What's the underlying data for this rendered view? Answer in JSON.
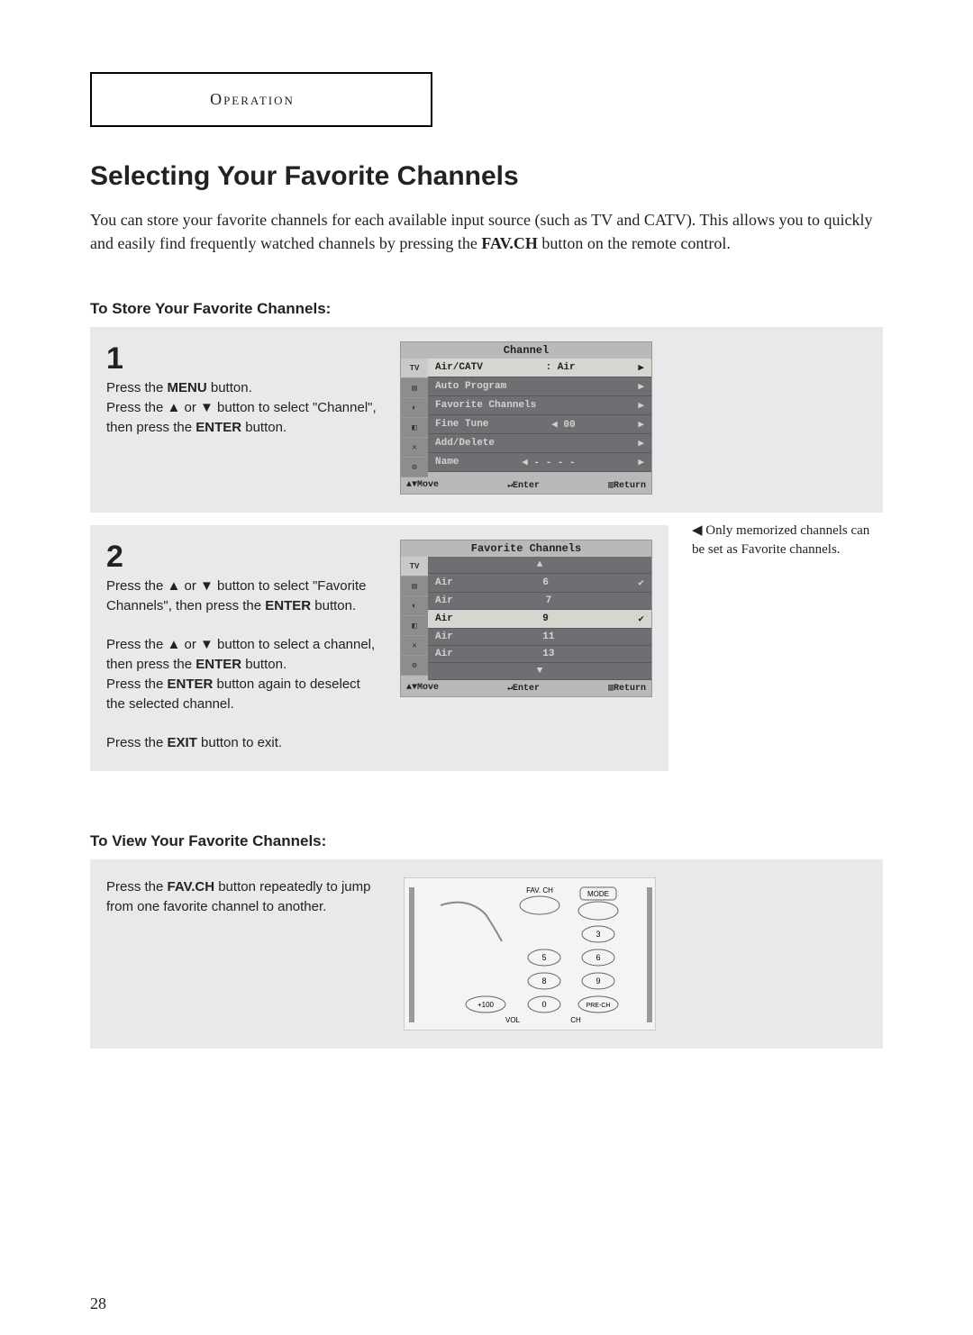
{
  "header": "Operation",
  "title": "Selecting Your Favorite Channels",
  "intro_p1": "You can store your favorite channels for each available input source (such as TV and CATV). This allows you to quickly and easily find frequently watched channels by pressing the ",
  "intro_fav": "FAV.CH",
  "intro_p2": " button on the remote control.",
  "store_heading": "To Store Your Favorite Channels:",
  "step1": {
    "num": "1",
    "a": "Press the ",
    "menu": "MENU",
    "b": " button.",
    "c": "Press the ▲ or ▼ button to select \"Channel\", then press the ",
    "enter": "ENTER",
    "d": " button."
  },
  "osd1": {
    "title": "Channel",
    "rows": [
      {
        "l": "Air/CATV",
        "m": ":  Air",
        "r": "▶",
        "sel": true
      },
      {
        "l": "Auto Program",
        "m": "",
        "r": "▶"
      },
      {
        "l": "Favorite Channels",
        "m": "",
        "r": "▶"
      },
      {
        "l": "Fine Tune",
        "m": "◀   00",
        "r": "▶"
      },
      {
        "l": "Add/Delete",
        "m": "",
        "r": "▶"
      },
      {
        "l": "Name",
        "m": "◀ - - - -",
        "r": "▶"
      }
    ],
    "footer": {
      "move": "▲▼Move",
      "enter": "↵Enter",
      "return": "▥Return"
    }
  },
  "step2": {
    "num": "2",
    "a": "Press the ▲ or ▼ button to select \"Favorite Channels\", then press the ",
    "enter1": "ENTER",
    "b": " button.",
    "c": "Press the ▲ or ▼ button to select a channel, then press the ",
    "enter2": "ENTER",
    "d": " button.",
    "e": "Press the ",
    "enter3": "ENTER",
    "f": " button again to deselect the selected channel.",
    "g": "Press the ",
    "exit": "EXIT",
    "h": " button to exit."
  },
  "osd2": {
    "title": "Favorite Channels",
    "rows": [
      {
        "l": "",
        "m": "▲",
        "r": ""
      },
      {
        "l": "Air",
        "m": "6",
        "r": "✔"
      },
      {
        "l": "Air",
        "m": "7",
        "r": ""
      },
      {
        "l": "Air",
        "m": "9",
        "r": "✔",
        "sel": true
      },
      {
        "l": "Air",
        "m": "11",
        "r": ""
      },
      {
        "l": "Air",
        "m": "13",
        "r": ""
      },
      {
        "l": "",
        "m": "▼",
        "r": ""
      }
    ],
    "footer": {
      "move": "▲▼Move",
      "enter": "↵Enter",
      "return": "▥Return"
    }
  },
  "note": "◀ Only memorized channels can be set as Favorite channels.",
  "view_heading": "To View Your Favorite Channels:",
  "view_step": {
    "a": "Press the ",
    "favch": "FAV.CH",
    "b": " button repeatedly to jump from one favorite channel to another."
  },
  "remote": {
    "favch": "FAV. CH",
    "mode": "MODE",
    "n3": "3",
    "n5": "5",
    "n6": "6",
    "n8": "8",
    "n9": "9",
    "n100": "+100",
    "n0": "0",
    "prech": "PRE-CH",
    "vol": "VOL",
    "ch": "CH"
  },
  "page": "28"
}
